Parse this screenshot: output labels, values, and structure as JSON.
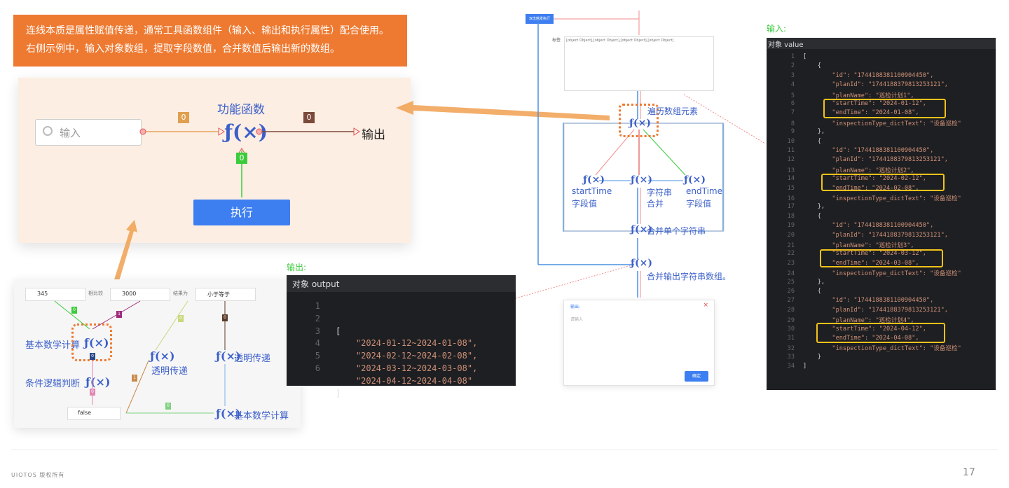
{
  "banner": {
    "text": "连线本质是属性赋值传递，通常工具函数组件（输入、输出和执行属性）配合使用。右侧示例中，输入对象数组，提取字段数值，合并数值后输出新的数组。"
  },
  "panel1": {
    "input_placeholder": "输入",
    "func_title": "功能函数",
    "output_label": "输出",
    "exec_button": "执行",
    "badge_left": "0",
    "badge_right": "0",
    "badge_bottom": "0"
  },
  "panel2": {
    "input1": "345",
    "label1": "相比较",
    "input2": "3000",
    "label2": "结果为",
    "input3": "小于等于",
    "basic_math": "基本数学计算",
    "cond_logic": "条件逻辑判断",
    "transparent1": "透明传递",
    "transparent2": "透明传递",
    "basic_math2": "基本数学计算",
    "false_value": "false",
    "badge_a": "0",
    "badge_b": "1",
    "badge_c": "0",
    "badge_d": "0",
    "badge_e": "1",
    "badge_f": "0",
    "badge_g": "0",
    "badge_h": "0"
  },
  "output_panel": {
    "caption": "输出:",
    "header": "对象 output",
    "line_numbers": [
      "1",
      "2",
      "3",
      "4",
      "5",
      "6"
    ],
    "lines": [
      "[",
      "    \"2024-01-12~2024-01-08\",",
      "    \"2024-02-12~2024-02-08\",",
      "    \"2024-03-12~2024-03-08\",",
      "    \"2024-04-12~2024-04-08\"",
      "]"
    ]
  },
  "flow": {
    "trigger_button": "双击触发执行",
    "table_label": "标签",
    "object_text": "[object Object],[object Object],[object Object],[object Object]",
    "iterate": "遍历数组元素",
    "start_label": "startTime",
    "start_sub": "字段值",
    "concat_label": "字符串",
    "concat_sub": "合并",
    "end_label": "endTime",
    "end_sub": "字段值",
    "merge_single": "合并单个字符串",
    "merge_output": "合并输出字符串数组。",
    "dialog_title": "输出:",
    "dialog_placeholder": "请输入",
    "dialog_ok": "确定",
    "dialog_close": "×"
  },
  "input_panel": {
    "caption": "输入:",
    "header": "对象 value",
    "line_numbers": [
      "1",
      "2",
      "3",
      "4",
      "5",
      "6",
      "7",
      "8",
      "9",
      "10",
      "11",
      "12",
      "13",
      "14",
      "15",
      "16",
      "17",
      "18",
      "19",
      "20",
      "21",
      "22",
      "23",
      "24",
      "25",
      "26",
      "27",
      "28",
      "29",
      "30",
      "31",
      "32",
      "33",
      "34"
    ],
    "lines": [
      "[",
      "    {",
      "        \"id\": \"1744188381100904450\",",
      "        \"planId\": \"1744188379813253121\",",
      "        \"planName\": \"巡检计划1\",",
      "        \"startTime\": \"2024-01-12\",",
      "        \"endTime\": \"2024-01-08\",",
      "        \"inspectionType_dictText\": \"设备巡检\"",
      "    },",
      "    {",
      "        \"id\": \"1744188381100904450\",",
      "        \"planId\": \"1744188379813253121\",",
      "        \"planName\": \"巡检计划2\",",
      "        \"startTime\": \"2024-02-12\",",
      "        \"endTime\": \"2024-02-08\",",
      "        \"inspectionType_dictText\": \"设备巡检\"",
      "    },",
      "    {",
      "        \"id\": \"1744188381100904450\",",
      "        \"planId\": \"1744188379813253121\",",
      "        \"planName\": \"巡检计划3\",",
      "        \"startTime\": \"2024-03-12\",",
      "        \"endTime\": \"2024-03-08\",",
      "        \"inspectionType_dictText\": \"设备巡检\"",
      "    },",
      "    {",
      "        \"id\": \"1744188381100904450\",",
      "        \"planId\": \"1744188379813253121\",",
      "        \"planName\": \"巡检计划4\",",
      "        \"startTime\": \"2024-04-12\",",
      "        \"endTime\": \"2024-04-08\",",
      "        \"inspectionType_dictText\": \"设备巡检\"",
      "    }",
      "]"
    ]
  },
  "footer": {
    "copyright": "UIOTOS 版权所有",
    "page_number": "17"
  },
  "colors": {
    "orange": "#ee7a31",
    "blue": "#3d7ef0",
    "yellow": "#f2c21b",
    "panel_bg": "#fdeee3"
  }
}
